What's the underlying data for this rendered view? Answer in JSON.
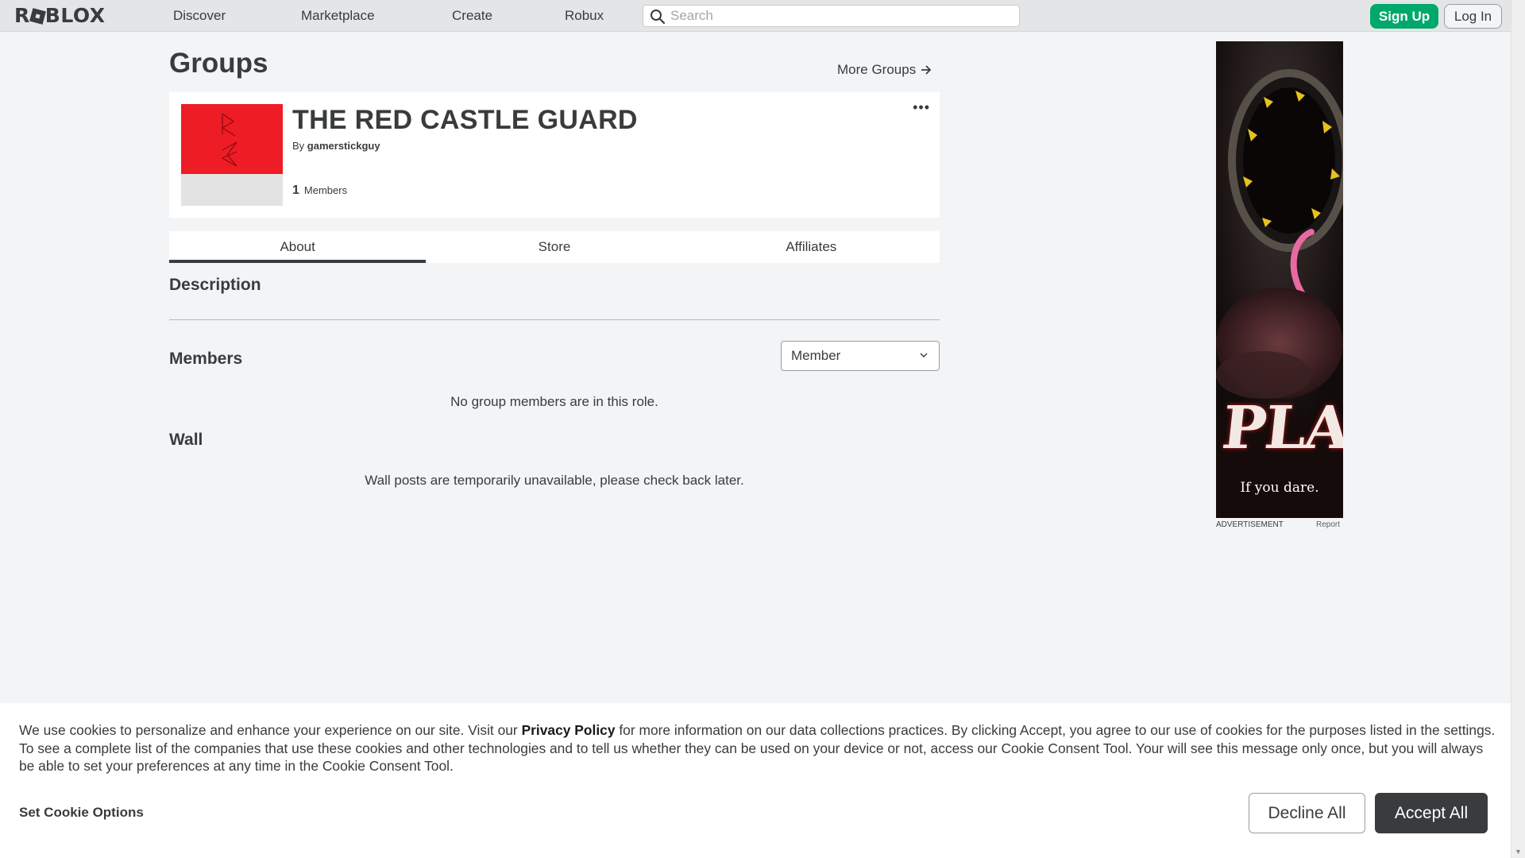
{
  "header": {
    "logo": "ROBLOX",
    "nav": [
      "Discover",
      "Marketplace",
      "Create",
      "Robux"
    ],
    "search_placeholder": "Search",
    "signup_label": "Sign Up",
    "login_label": "Log In"
  },
  "page": {
    "title": "Groups",
    "more_groups": "More Groups"
  },
  "group": {
    "name": "THE RED CASTLE GUARD",
    "by": "By",
    "owner": "gamerstickguy",
    "member_count": "1",
    "members_label": "Members"
  },
  "tabs": [
    "About",
    "Store",
    "Affiliates"
  ],
  "about": {
    "description_heading": "Description",
    "members_heading": "Members",
    "role_selected": "Member",
    "members_empty": "No group members are in this role.",
    "wall_heading": "Wall",
    "wall_empty": "Wall posts are temporarily unavailable, please check back later."
  },
  "ad": {
    "play_text": "PLAY",
    "tagline": "If you dare.",
    "label": "ADVERTISEMENT",
    "report": "Report"
  },
  "cookie": {
    "text_before": "We use cookies to personalize and enhance your experience on our site. Visit our ",
    "link": "Privacy Policy",
    "text_after": " for more information on our data collections practices. By clicking Accept, you agree to our use of cookies for the purposes listed in the settings. To see a complete list of the companies that use these cookies and other technologies and to tell us whether they can be used on your device or not, access our Cookie Consent Tool. Your will see this message only once, but you will always be able to set your preferences at any time in the Cookie Consent Tool.",
    "set_options": "Set Cookie Options",
    "decline": "Decline All",
    "accept": "Accept All"
  },
  "colors": {
    "accent_green": "#00a86b",
    "emblem_red": "#ee1c24",
    "dark": "#393b3d"
  }
}
